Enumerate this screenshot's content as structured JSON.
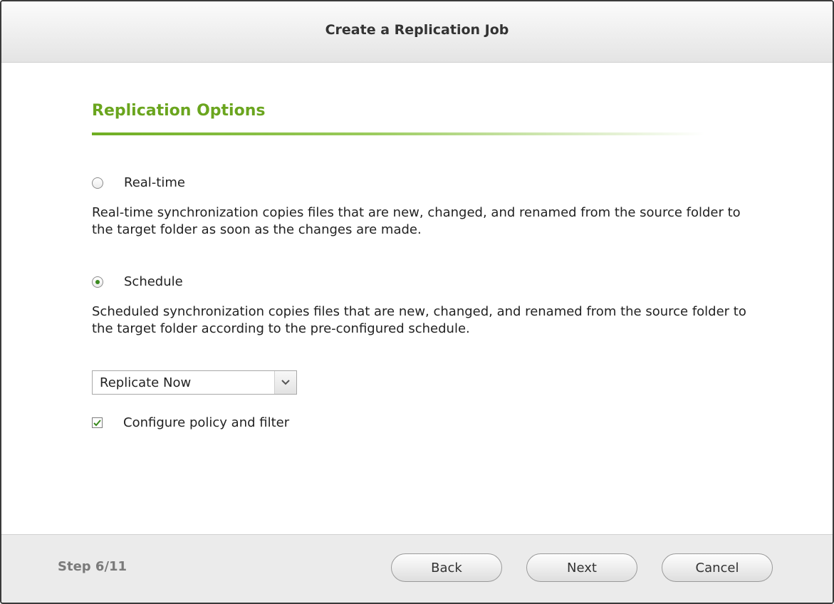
{
  "dialog": {
    "title": "Create a Replication Job"
  },
  "section": {
    "title": "Replication Options"
  },
  "options": {
    "realtime": {
      "label": "Real-time",
      "selected": false,
      "description": "Real-time synchronization copies files that are new, changed, and renamed from the source folder to the target folder as soon as the changes are made."
    },
    "schedule": {
      "label": "Schedule",
      "selected": true,
      "description": "Scheduled synchronization copies files that are new, changed, and renamed from the source folder to the target folder according to the pre-configured schedule."
    }
  },
  "schedule_select": {
    "value": "Replicate Now"
  },
  "policy_checkbox": {
    "label": "Configure policy and filter",
    "checked": true
  },
  "footer": {
    "step": "Step 6/11",
    "back_label": "Back",
    "next_label": "Next",
    "cancel_label": "Cancel"
  },
  "colors": {
    "accent": "#6aa51e",
    "check": "#3a8a1e"
  }
}
